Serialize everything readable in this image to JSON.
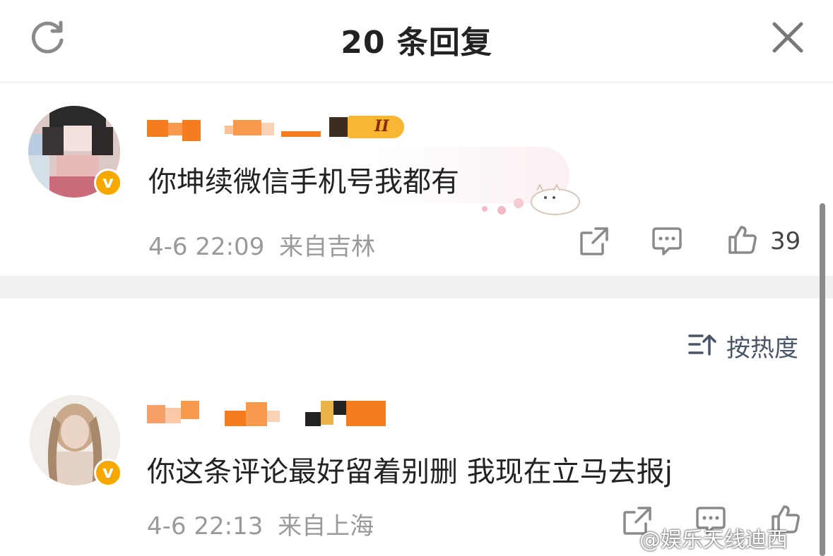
{
  "header": {
    "title": "20 条回复"
  },
  "comments": [
    {
      "text": "你坤续微信手机号我都有",
      "time": "4-6 22:09",
      "location": "来自吉林",
      "likes": "39",
      "level_badge": "II"
    },
    {
      "text": "你这条评论最好留着别删 我现在立马去报j",
      "time": "4-6 22:13",
      "location": "来自上海"
    }
  ],
  "sort": {
    "label": "按热度"
  },
  "watermark": "@娱乐天线迪西",
  "colors": {
    "verified": "#f6a800",
    "name_orange": "#f57c1f",
    "meta_gray": "#9a9a9a",
    "separator": "#f0f0f0"
  },
  "icons": [
    "refresh-icon",
    "close-icon",
    "share-icon",
    "comment-icon",
    "like-icon",
    "sort-icon",
    "verified-icon"
  ]
}
